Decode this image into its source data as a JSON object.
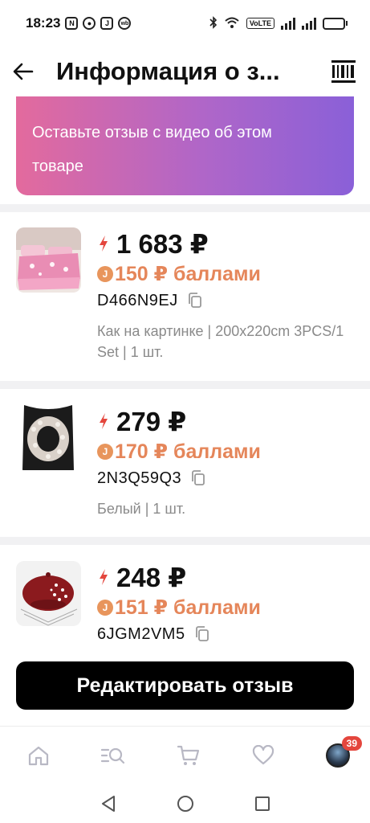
{
  "status_bar": {
    "time": "18:23",
    "icons": [
      "nfc-icon",
      "chat-icon",
      "j-app-icon",
      "wb-icon"
    ],
    "volte": "VoLTE",
    "wifi_label": "6",
    "battery_level": 0.45
  },
  "header": {
    "title": "Информация о з...",
    "back_icon": "arrow-left-icon",
    "barcode_icon": "barcode-icon"
  },
  "banner": {
    "text": "Оставьте отзыв с видео об этом товаре"
  },
  "products": [
    {
      "price": "1 683 ₽",
      "points": "150 ₽ баллами",
      "sku": "D466N9EJ",
      "variant": "Как на картинке | 200x220cm 3PCS/1 Set | 1 шт.",
      "image": "pink-bedding-set"
    },
    {
      "price": "279 ₽",
      "points": "170 ₽ баллами",
      "sku": "2N3Q59Q3",
      "variant": "Белый | 1 шт.",
      "image": "pearl-necklace"
    },
    {
      "price": "248 ₽",
      "points": "151 ₽ баллами",
      "sku": "6JGM2VM5",
      "variant": "",
      "image": "red-beret-with-pearls"
    }
  ],
  "coin_symbol": "J",
  "edit_button": {
    "label": "Редактировать отзыв"
  },
  "bottom_nav": {
    "items": [
      "home-icon",
      "catalog-search-icon",
      "cart-icon",
      "favorites-icon",
      "profile-avatar"
    ],
    "badge_count": "39"
  },
  "colors": {
    "points": "#e5865a",
    "bolt": "#e4463d",
    "banner_start": "#e36a9d",
    "banner_end": "#8a60d8",
    "badge": "#e4463d"
  }
}
